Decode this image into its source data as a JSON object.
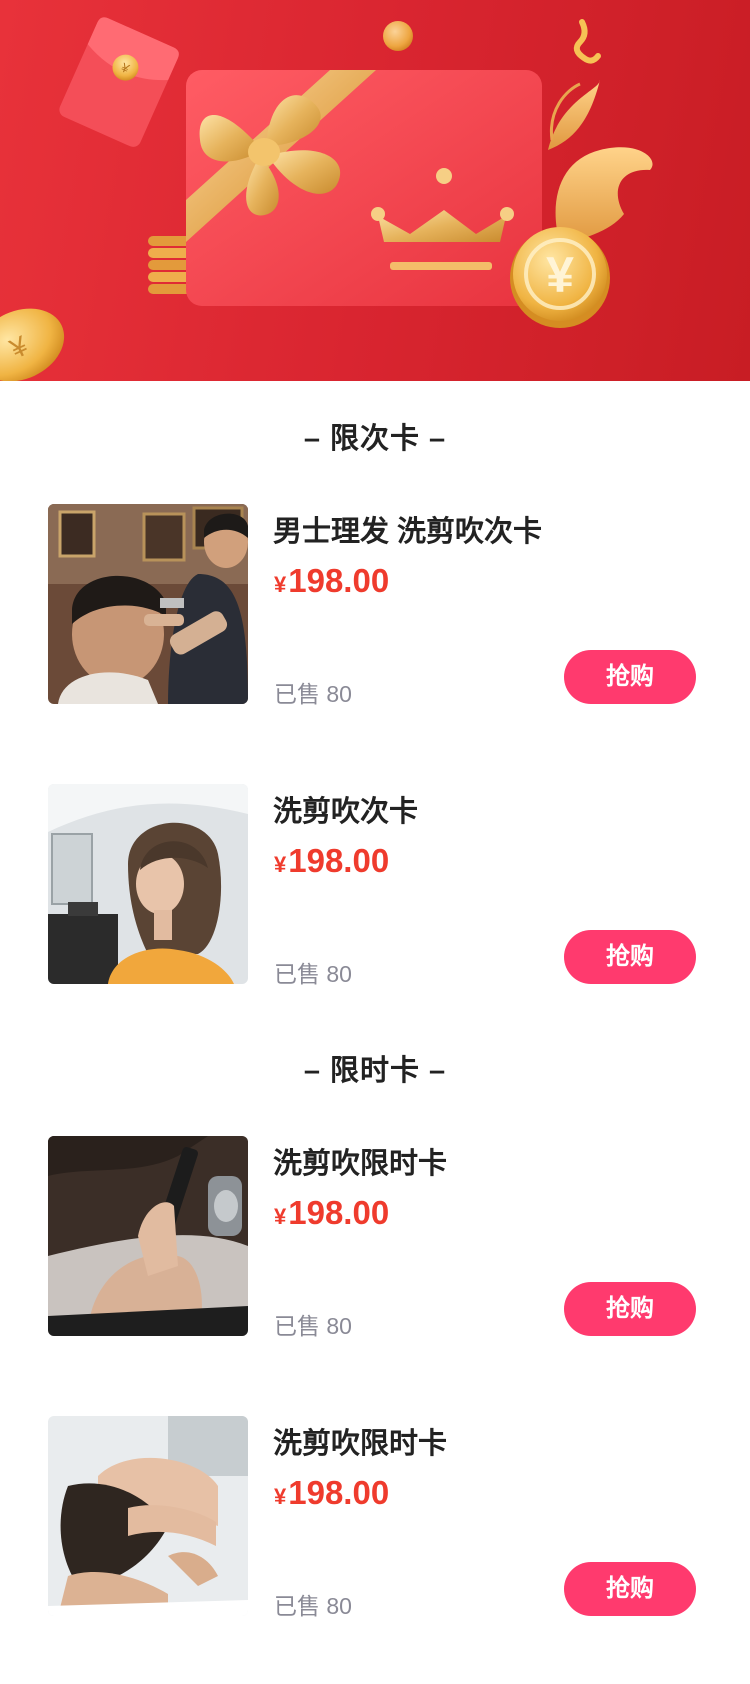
{
  "sections": [
    {
      "title": "– 限次卡 –"
    },
    {
      "title": "– 限时卡 –"
    }
  ],
  "products": [
    {
      "name": "男士理发 洗剪吹次卡",
      "currency": "¥",
      "price": "198.00",
      "sold": "已售 80",
      "button": "抢购"
    },
    {
      "name": "洗剪吹次卡",
      "currency": "¥",
      "price": "198.00",
      "sold": "已售 80",
      "button": "抢购"
    },
    {
      "name": "洗剪吹限时卡",
      "currency": "¥",
      "price": "198.00",
      "sold": "已售 80",
      "button": "抢购"
    },
    {
      "name": "洗剪吹限时卡",
      "currency": "¥",
      "price": "198.00",
      "sold": "已售 80",
      "button": "抢购"
    }
  ],
  "banner": {
    "coin_symbol": "¥"
  },
  "colors": {
    "banner_red": "#d92530",
    "price_red": "#ef3b2d",
    "buy_button": "#ff3a6e",
    "gold": "#f2c46a"
  }
}
